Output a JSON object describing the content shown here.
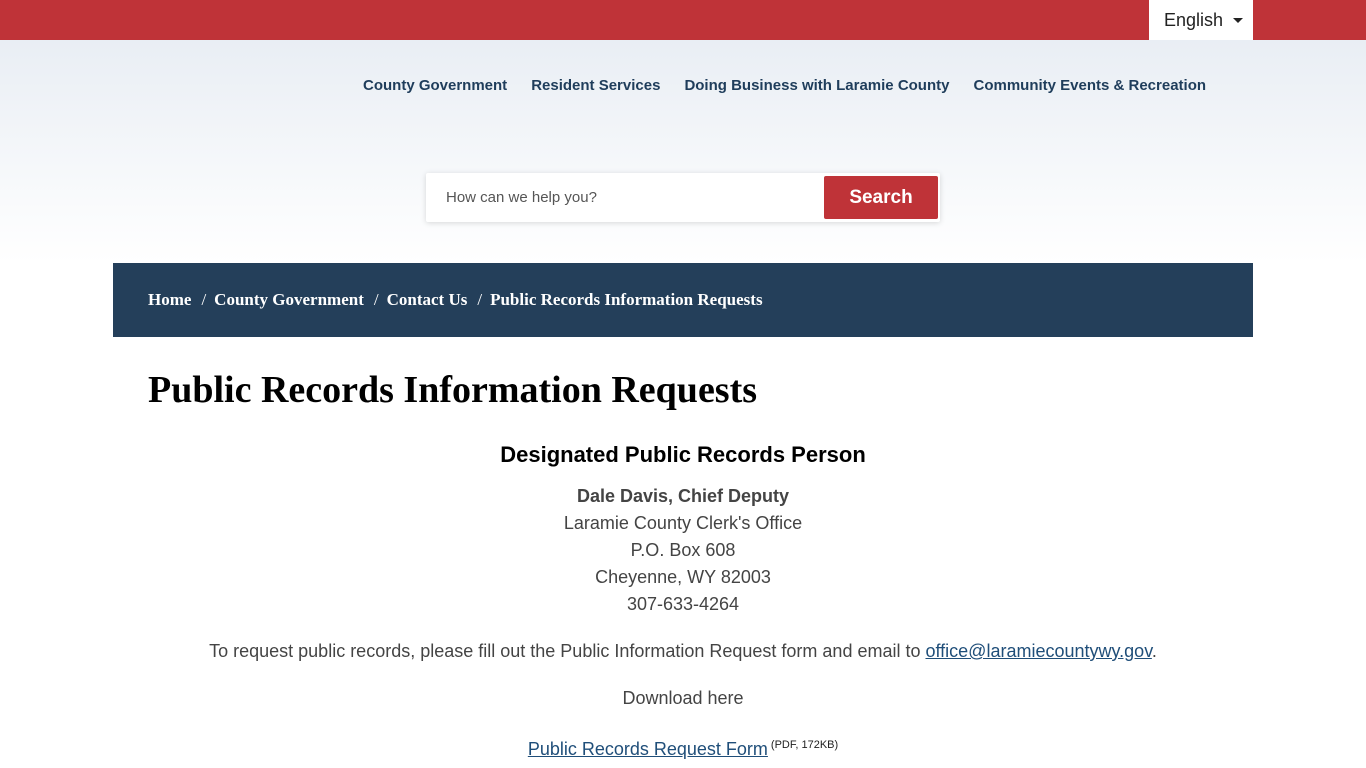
{
  "language": {
    "selected": "English"
  },
  "nav": {
    "items": [
      {
        "label": "County Government"
      },
      {
        "label": "Resident Services"
      },
      {
        "label": "Doing Business with Laramie County"
      },
      {
        "label": "Community Events & Recreation"
      }
    ]
  },
  "search": {
    "placeholder": "How can we help you?",
    "button_label": "Search"
  },
  "breadcrumb": {
    "items": [
      "Home",
      "County Government",
      "Contact Us",
      "Public Records Information Requests"
    ],
    "separator": "/"
  },
  "page": {
    "title": "Public Records Information Requests"
  },
  "contact": {
    "heading": "Designated Public Records Person",
    "name": "Dale Davis, Chief Deputy",
    "office": "Laramie County Clerk's Office",
    "po_box": "P.O. Box 608",
    "city": "Cheyenne, WY 82003",
    "phone": "307-633-4264"
  },
  "request": {
    "text": "To request public records, please fill out the Public Information Request form and email to ",
    "email": "office@laramiecountywy.gov",
    "period": "."
  },
  "download": {
    "text": "Download here",
    "form_link": "Public Records Request Form",
    "form_meta": "(PDF, 172KB)"
  },
  "colors": {
    "brand_red": "#bf3338",
    "navy": "#243f5a",
    "nav_text": "#1f3d5b"
  }
}
